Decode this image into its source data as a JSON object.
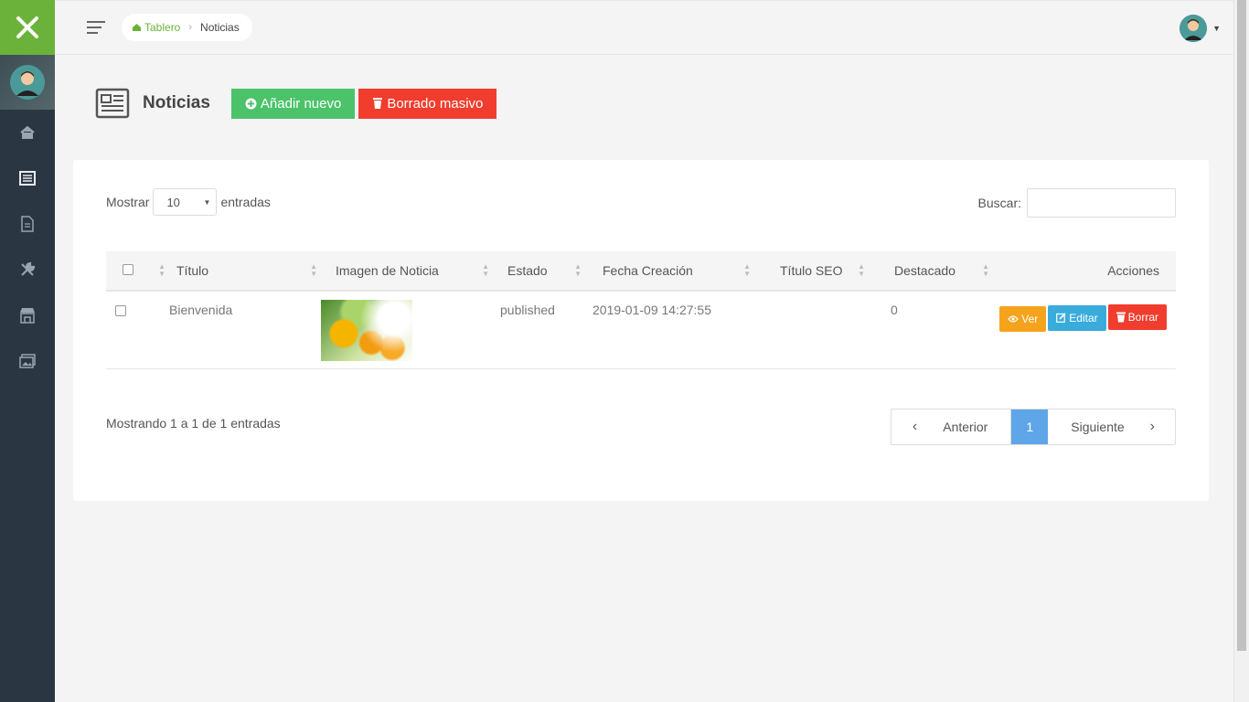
{
  "breadcrumb": {
    "home": "Tablero",
    "current": "Noticias"
  },
  "page": {
    "title": "Noticias",
    "add_label": "Añadir nuevo",
    "bulk_delete_label": "Borrado masivo"
  },
  "table_controls": {
    "show_prefix": "Mostrar",
    "show_value": "10",
    "show_suffix": "entradas",
    "search_label": "Buscar:",
    "search_value": ""
  },
  "table": {
    "headers": [
      "Título",
      "Imagen de Noticia",
      "Estado",
      "Fecha Creación",
      "Título SEO",
      "Destacado",
      "Acciones"
    ],
    "rows": [
      {
        "titulo": "Bienvenida",
        "image": "orange-juice-image",
        "estado": "published",
        "fecha": "2019-01-09 14:27:55",
        "seo": "",
        "destacado": "0"
      }
    ],
    "row_actions": {
      "view": "Ver",
      "edit": "Editar",
      "delete": "Borrar"
    }
  },
  "footer": {
    "info": "Mostrando 1 a 1 de 1 entradas",
    "prev": "Anterior",
    "page": "1",
    "next": "Siguiente"
  },
  "colors": {
    "brand_green": "#6bb23a",
    "sidebar": "#2b3643",
    "add": "#4cc36a",
    "danger": "#f03d2e",
    "view": "#f5a31c",
    "edit": "#3aacdb",
    "active_page": "#5fa6e8"
  },
  "sidebar": {
    "items": [
      "home-icon",
      "news-icon",
      "document-icon",
      "tools-icon",
      "store-icon",
      "gallery-icon"
    ]
  }
}
